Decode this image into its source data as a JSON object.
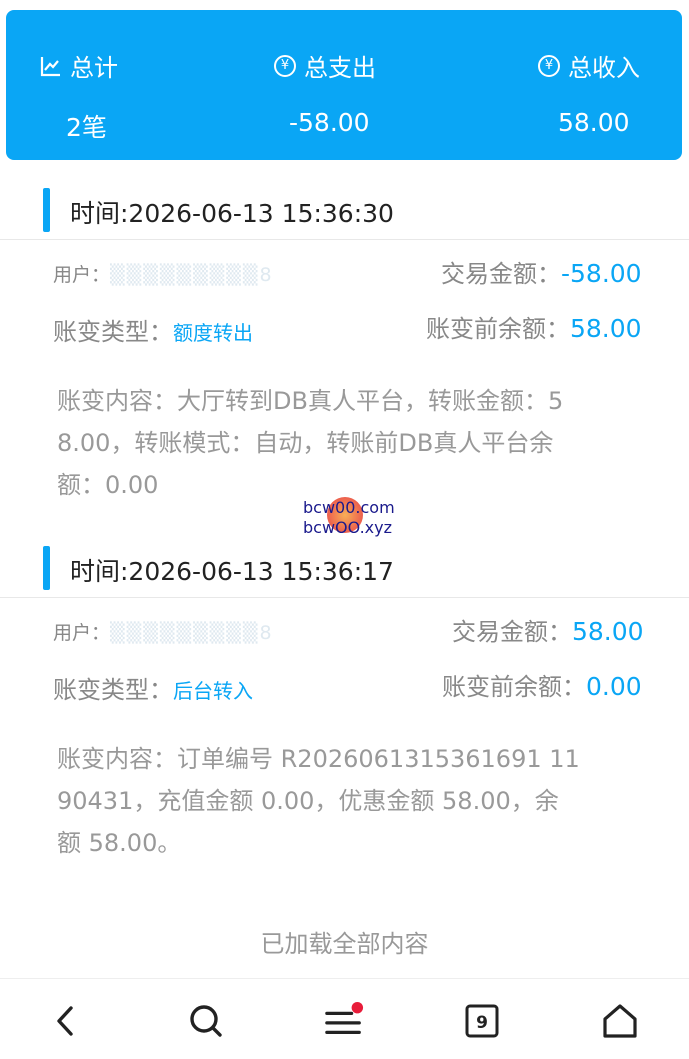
{
  "summary": {
    "total_label": "总计",
    "expense_label": "总支出",
    "income_label": "总收入",
    "total_value": "2笔",
    "expense_value": "-58.00",
    "income_value": "58.00",
    "currency_symbol": "¥"
  },
  "records": [
    {
      "time": "时间:2026-06-13 15:36:30",
      "user_label": "用户：",
      "user_masked": "▒▒▒▒▒▒▒▒▒8",
      "amount_label": "交易金额：",
      "amount": "-58.00",
      "type_label": "账变类型：",
      "type": "额度转出",
      "balance_label": "账变前余额：",
      "balance": "58.00",
      "content_lines": [
        "账变内容：大厅转到DB真人平台，转账金额：5",
        "8.00，转账模式：自动，转账前DB真人平台余",
        "额：0.00"
      ]
    },
    {
      "time": "时间:2026-06-13 15:36:17",
      "user_label": "用户：",
      "user_masked": "▒▒▒▒▒▒▒▒▒8",
      "amount_label": "交易金额：",
      "amount": "58.00",
      "type_label": "账变类型：",
      "type": "后台转入",
      "balance_label": "账变前余额：",
      "balance": "0.00",
      "content_lines": [
        "账变内容：订单编号 R2026061315361691 11",
        "90431，充值金额 0.00，优惠金额 58.00，余",
        "额 58.00。"
      ]
    }
  ],
  "watermark": {
    "line1": "bcw00.com",
    "line2": "bcwOO.xyz"
  },
  "footer_note": "已加载全部内容",
  "nav": {
    "tab_count": "9"
  },
  "colors": {
    "accent": "#0aa6f5",
    "notification": "#e81c3a"
  }
}
